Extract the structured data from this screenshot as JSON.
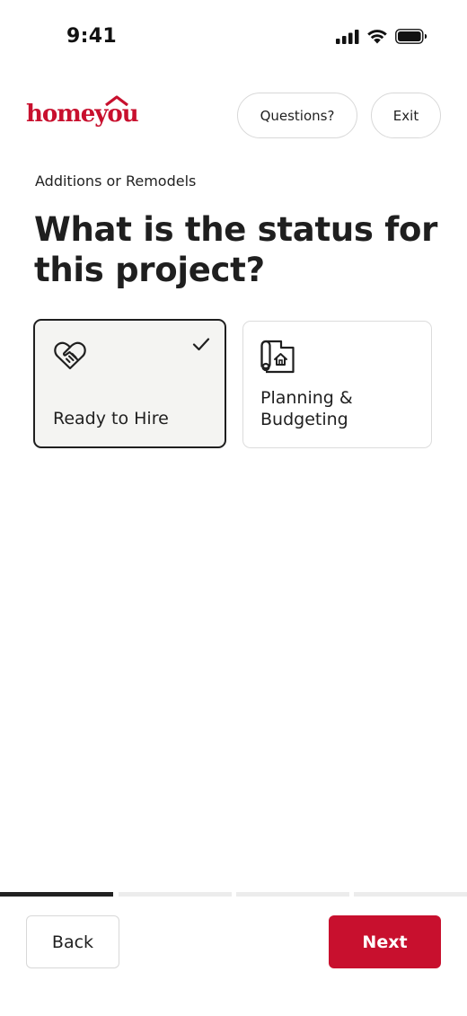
{
  "status_bar": {
    "time": "9:41",
    "icons": [
      "signal-icon",
      "wifi-icon",
      "battery-icon"
    ]
  },
  "header": {
    "logo_text": "homeyou",
    "questions_label": "Questions?",
    "exit_label": "Exit"
  },
  "main": {
    "subtitle": "Additions or Remodels",
    "title": "What is the status for this project?",
    "options": [
      {
        "label": "Ready to Hire",
        "icon": "handshake-heart-icon",
        "selected": true
      },
      {
        "label": "Planning & Budgeting",
        "icon": "blueprint-house-icon",
        "selected": false
      }
    ]
  },
  "progress": {
    "steps": 4,
    "current": 1
  },
  "footer": {
    "back_label": "Back",
    "next_label": "Next"
  },
  "colors": {
    "brand": "#c8102e",
    "text": "#1f1f1f",
    "selected_bg": "#f4f4f2"
  }
}
